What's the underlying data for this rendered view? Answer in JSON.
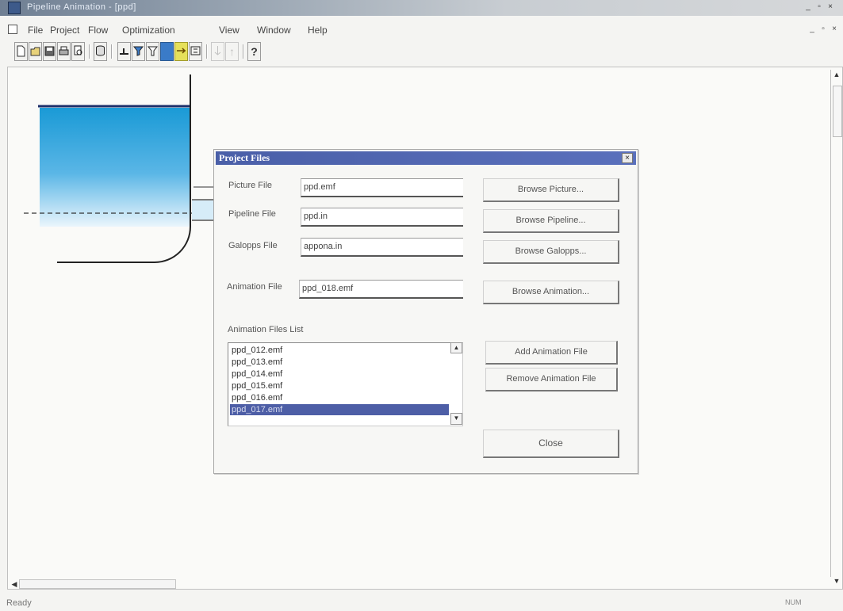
{
  "window": {
    "title": "Pipeline Animation - [ppd]",
    "controls": {
      "minimize": "_",
      "maximize": "▫",
      "close": "×"
    }
  },
  "menu": {
    "items": [
      "File",
      "Project",
      "Flow",
      "Optimization",
      "View",
      "Window",
      "Help"
    ],
    "mdi_controls": {
      "minimize": "_",
      "maximize": "▫",
      "close": "×"
    }
  },
  "toolbar": {
    "help_glyph": "?",
    "up_glyph": "↑"
  },
  "dialog": {
    "title": "Project Files",
    "close_glyph": "×",
    "picture_label": "Picture File",
    "picture_value": "ppd.emf",
    "pipeline_label": "Pipeline File",
    "pipeline_value": "ppd.in",
    "galopps_label": "Galopps File",
    "galopps_value": "appona.in",
    "animation_label": "Animation File",
    "animation_value": "ppd_018.emf",
    "list_label": "Animation Files List",
    "list_items": [
      "ppd_012.emf",
      "ppd_013.emf",
      "ppd_014.emf",
      "ppd_015.emf",
      "ppd_016.emf",
      "ppd_017.emf"
    ],
    "selected_index": 5,
    "buttons": {
      "browse_picture": "Browse Picture...",
      "browse_pipeline": "Browse Pipeline...",
      "browse_galopps": "Browse Galopps...",
      "browse_animation": "Browse Animation...",
      "add_animation": "Add Animation File",
      "remove_animation": "Remove Animation File",
      "close": "Close"
    }
  },
  "statusbar": {
    "text": "Ready",
    "right": "NUM"
  },
  "colors": {
    "title_bar": "#6f7f93",
    "dialog_title": "#4a5fa8",
    "selection": "#4d5ea6",
    "tank_fill_top": "#1a9ad6",
    "tank_fill_bottom": "#e8f4fc"
  }
}
